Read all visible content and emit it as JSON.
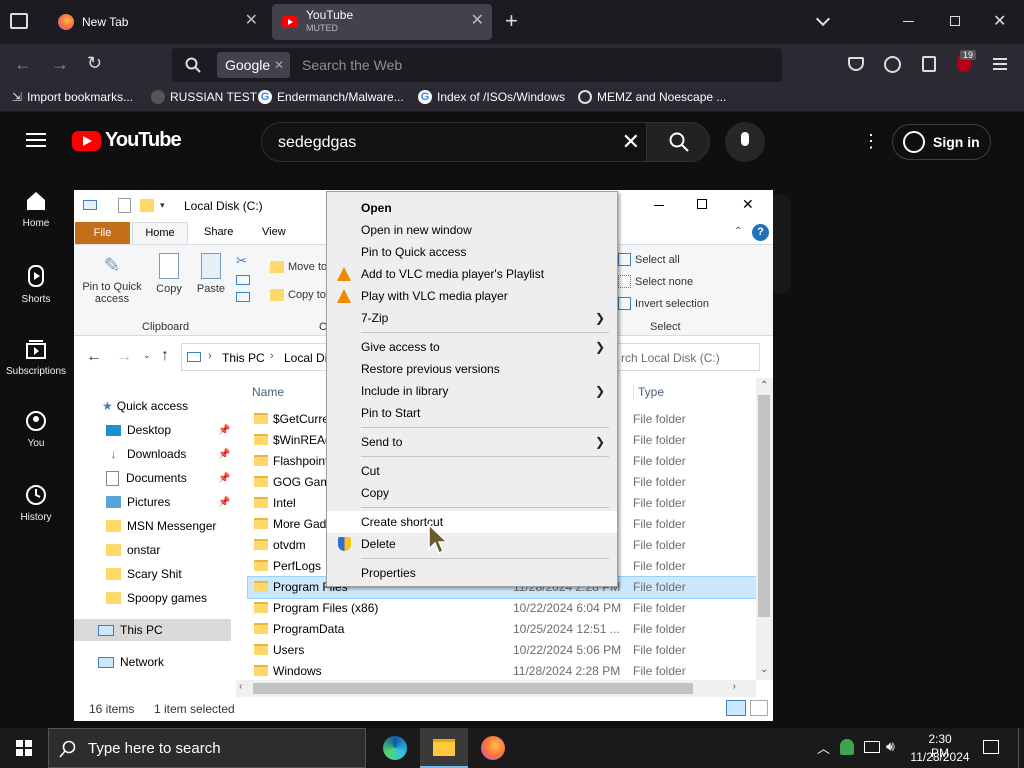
{
  "browser": {
    "tabs": [
      {
        "title": "New Tab"
      },
      {
        "title": "YouTube",
        "subtitle": "MUTED"
      }
    ],
    "search_engine": "Google",
    "url_placeholder": "Search the Web",
    "extension_badge": "19",
    "bookmarks": [
      "Import bookmarks...",
      "RUSSIAN TEST",
      "Endermanch/Malware...",
      "Index of /ISOs/Windows",
      "MEMZ and Noescape ..."
    ]
  },
  "youtube": {
    "logo": "YouTube",
    "search_value": "sedegdgas",
    "sign_in": "Sign in",
    "sidebar": [
      "Home",
      "Shorts",
      "Subscriptions",
      "You",
      "History"
    ]
  },
  "explorer": {
    "title": "Local Disk (C:)",
    "ribbon_tabs": [
      "File",
      "Home",
      "Share",
      "View"
    ],
    "clipboard": {
      "pin": "Pin to Quick access",
      "copy": "Copy",
      "paste": "Paste",
      "group": "Clipboard"
    },
    "organize": {
      "move": "Move to",
      "copy": "Copy to"
    },
    "select": {
      "all": "Select all",
      "none": "Select none",
      "invert": "Invert selection",
      "group": "Select"
    },
    "breadcrumb": [
      "This PC",
      "Local Di"
    ],
    "search_placeholder": "rch Local Disk (C:)",
    "columns": {
      "name": "Name",
      "type": "Type"
    },
    "quick_access": "Quick access",
    "nav": [
      {
        "label": "Desktop",
        "pinned": true
      },
      {
        "label": "Downloads",
        "pinned": true
      },
      {
        "label": "Documents",
        "pinned": true
      },
      {
        "label": "Pictures",
        "pinned": true
      },
      {
        "label": "MSN Messenger"
      },
      {
        "label": "onstar"
      },
      {
        "label": "Scary Shit"
      },
      {
        "label": "Spoopy games"
      }
    ],
    "this_pc": "This PC",
    "network": "Network",
    "files": [
      {
        "name": "$GetCurre",
        "date": "",
        "type": "File folder"
      },
      {
        "name": "$WinREAg",
        "date": "",
        "type": "File folder"
      },
      {
        "name": "Flashpoint",
        "date": "",
        "type": "File folder"
      },
      {
        "name": "GOG Gam",
        "date": "",
        "type": "File folder"
      },
      {
        "name": "Intel",
        "date": "",
        "type": "File folder"
      },
      {
        "name": "More Gad",
        "date": "",
        "type": "File folder"
      },
      {
        "name": "otvdm",
        "date": "",
        "type": "File folder"
      },
      {
        "name": "PerfLogs",
        "date": "",
        "type": "File folder"
      },
      {
        "name": "Program Files",
        "date": "11/28/2024 2:28 PM",
        "type": "File folder",
        "selected": true
      },
      {
        "name": "Program Files (x86)",
        "date": "10/22/2024 6:04 PM",
        "type": "File folder"
      },
      {
        "name": "ProgramData",
        "date": "10/25/2024 12:51 ...",
        "type": "File folder"
      },
      {
        "name": "Users",
        "date": "10/22/2024 5:06 PM",
        "type": "File folder"
      },
      {
        "name": "Windows",
        "date": "11/28/2024 2:28 PM",
        "type": "File folder"
      }
    ],
    "status": {
      "count": "16 items",
      "selected": "1 item selected"
    }
  },
  "context_menu": {
    "items": [
      {
        "label": "Open",
        "bold": true
      },
      {
        "label": "Open in new window"
      },
      {
        "label": "Pin to Quick access"
      },
      {
        "label": "Add to VLC media player's Playlist",
        "icon": "vlc-icon"
      },
      {
        "label": "Play with VLC media player",
        "icon": "vlc-icon"
      },
      {
        "label": "7-Zip",
        "submenu": true
      },
      {
        "label": "Give access to",
        "submenu": true
      },
      {
        "label": "Restore previous versions"
      },
      {
        "label": "Include in library",
        "submenu": true
      },
      {
        "label": "Pin to Start"
      },
      {
        "label": "Send to",
        "submenu": true
      },
      {
        "label": "Cut"
      },
      {
        "label": "Copy"
      },
      {
        "label": "Create shortcut",
        "hover": true
      },
      {
        "label": "Delete",
        "icon": "shield-icon"
      },
      {
        "label": "Properties"
      }
    ]
  },
  "taskbar": {
    "search_placeholder": "Type here to search",
    "time": "2:30 PM",
    "date": "11/28/2024"
  },
  "colors": {
    "youtube_red": "#ff0000",
    "file_tab": "#c36f1a",
    "selection": "#cce8ff",
    "hover": "#e5f3ff"
  }
}
